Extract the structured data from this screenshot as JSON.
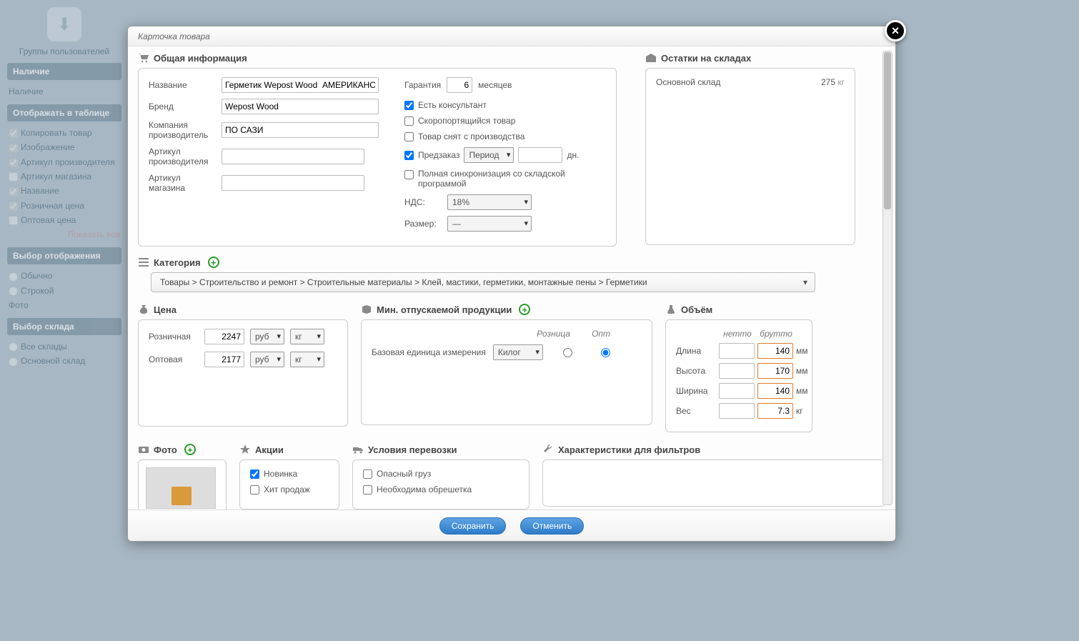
{
  "modal": {
    "title": "Карточка товара"
  },
  "close_label": "×",
  "sections": {
    "general": "Общая информация",
    "stock": "Остатки на складах",
    "category": "Категория",
    "price": "Цена",
    "minrelease": "Мин. отпускаемой продукции",
    "volume": "Объём",
    "photo": "Фото",
    "promo": "Акции",
    "shipping": "Условия перевозки",
    "filters": "Характеристики для фильтров"
  },
  "general": {
    "name_label": "Название",
    "name_value": "Герметик Wepost Wood  АМЕРИКАНСКАЯ",
    "brand_label": "Бренд",
    "brand_value": "Wepost Wood",
    "manufacturer_label": "Компания производитель",
    "manufacturer_value": "ПО САЗИ",
    "sku_mfr_label": "Артикул производителя",
    "sku_mfr_value": "",
    "sku_store_label": "Артикул магазина",
    "sku_store_value": "",
    "warranty_label": "Гарантия",
    "warranty_value": "6",
    "warranty_unit": "месяцев",
    "consultant_label": "Есть консультант",
    "perishable_label": "Скоропортящийся товар",
    "discontinued_label": "Товар снят с производства",
    "preorder_label": "Предзаказ",
    "preorder_period_label": "Период",
    "preorder_days_label": "дн.",
    "preorder_days_value": "",
    "sync_label": "Полная синхронизация со складской программой",
    "vat_label": "НДС:",
    "vat_value": "18%",
    "size_label": "Размер:",
    "size_value": "—",
    "consultant_checked": true,
    "perishable_checked": false,
    "discontinued_checked": false,
    "preorder_checked": true,
    "sync_checked": false
  },
  "stock": {
    "rows": [
      {
        "name": "Основной склад",
        "qty": "275",
        "unit": "кг"
      }
    ]
  },
  "category": {
    "path": "Товары > Строительство и ремонт > Строительные материалы > Клей, мастики, герметики, монтажные пены > Герметики"
  },
  "price": {
    "retail_label": "Розничная",
    "retail_value": "2247",
    "wholesale_label": "Оптовая",
    "wholesale_value": "2177",
    "currency": "руб",
    "weight_unit": "кг"
  },
  "minrelease": {
    "retail_head": "Розница",
    "wholesale_head": "Опт",
    "base_label": "Базовая единица измерения",
    "base_unit": "Килог",
    "selected": "wholesale"
  },
  "volume": {
    "net_head": "нетто",
    "gross_head": "брутто",
    "length_label": "Длина",
    "length_net": "",
    "length_gross": "140",
    "length_unit": "мм",
    "height_label": "Высота",
    "height_net": "",
    "height_gross": "170",
    "height_unit": "мм",
    "width_label": "Ширина",
    "width_net": "",
    "width_gross": "140",
    "width_unit": "мм",
    "weight_label": "Вес",
    "weight_net": "",
    "weight_gross": "7.3",
    "weight_unit": "кг"
  },
  "promo": {
    "new_label": "Новинка",
    "hit_label": "Хит продаж",
    "new_checked": true,
    "hit_checked": false
  },
  "shipping": {
    "danger_label": "Опасный груз",
    "crate_label": "Необходима обрешетка",
    "danger_checked": false,
    "crate_checked": false
  },
  "footer": {
    "save": "Сохранить",
    "cancel": "Отменить"
  },
  "sidebar": {
    "groups_label": "Группы пользователей",
    "availability_header": "Наличие",
    "availability_item": "Наличие",
    "table_header": "Отображать в таблице",
    "table_items": [
      "Копировать товар",
      "Изображение",
      "Артикул производителя",
      "Артикул магазина",
      "Название",
      "Розничная цена",
      "Оптовая цена"
    ],
    "table_checked": [
      true,
      true,
      true,
      false,
      true,
      true,
      false
    ],
    "show_all": "Показать все",
    "view_header": "Выбор отображения",
    "view_items": [
      "Обычно",
      "Строкой"
    ],
    "photo_label": "Фото",
    "warehouse_header": "Выбор склада",
    "warehouse_items": [
      "Все склады",
      "Основной склад"
    ]
  }
}
